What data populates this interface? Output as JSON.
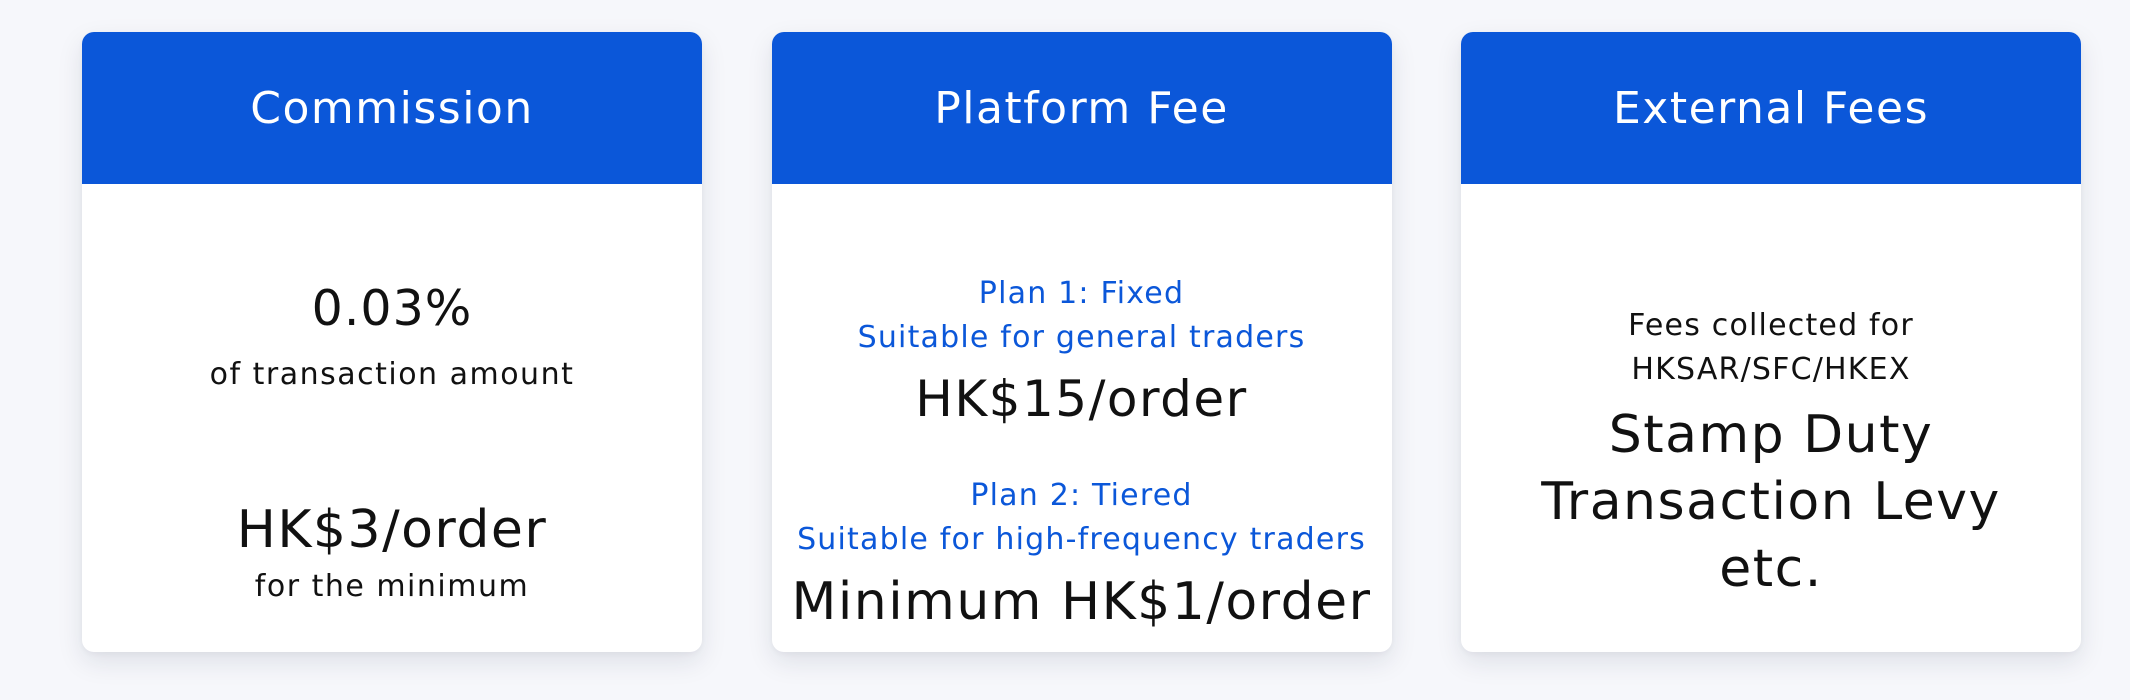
{
  "cards": [
    {
      "title": "Commission",
      "rate": "0.03%",
      "rate_note": "of transaction amount",
      "minimum": "HK$3/order",
      "minimum_note": "for the minimum"
    },
    {
      "title": "Platform Fee",
      "plan1": {
        "name": "Plan 1: Fixed",
        "description": "Suitable for general traders",
        "price": "HK$15/order"
      },
      "plan2": {
        "name": "Plan 2: Tiered",
        "description": "Suitable for high-frequency traders",
        "price": "Minimum HK$1/order"
      }
    },
    {
      "title": "External Fees",
      "description_line1": "Fees collected for",
      "description_line2": "HKSAR/SFC/HKEX",
      "items": [
        "Stamp Duty",
        "Transaction Levy",
        "etc."
      ]
    }
  ],
  "colors": {
    "header_blue": "#0b57d9",
    "page_background": "#f6f7fb",
    "card_background": "#ffffff",
    "text_dark": "#111111"
  }
}
